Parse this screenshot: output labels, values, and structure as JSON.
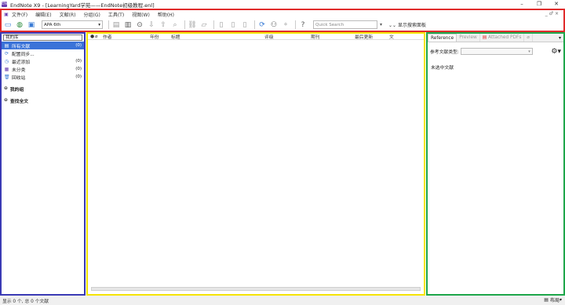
{
  "window": {
    "title": "EndNote X9 - [LearningYard学苑——EndNote初级教程.enl]",
    "controls": [
      "–",
      "❐",
      "✕"
    ]
  },
  "menu": {
    "items": [
      "文件(F)",
      "编辑(E)",
      "文献(R)",
      "分组(G)",
      "工具(T)",
      "视图(W)",
      "帮助(H)"
    ],
    "window_controls": "_ ♂ ×"
  },
  "toolbar": {
    "style_value": "APA 6th",
    "search_placeholder": "Quick Search",
    "show_search_label": "显示搜索面板"
  },
  "groups": {
    "header": "我的库",
    "items": [
      {
        "label": "所有文献",
        "count": "(0)",
        "icon": "library-icon",
        "glyph": "▤"
      },
      {
        "label": "配置同步...",
        "count": "",
        "icon": "sync-icon",
        "glyph": "⟳"
      },
      {
        "label": "最近添加",
        "count": "(0)",
        "icon": "clock-icon",
        "glyph": "◷"
      },
      {
        "label": "未分类",
        "count": "(0)",
        "icon": "unfiled-icon",
        "glyph": "▦"
      },
      {
        "label": "回收站",
        "count": "(0)",
        "icon": "trash-icon",
        "glyph": "🗑"
      }
    ],
    "sections": [
      "我的组",
      "查找全文"
    ]
  },
  "reference_list": {
    "columns": [
      "作者",
      "年份",
      "标题",
      "评级",
      "期刊",
      "最后更新",
      "文"
    ]
  },
  "right_panel": {
    "tabs": [
      "Reference",
      "Preview",
      "Attached PDFs"
    ],
    "ref_type_label": "参考文献类型:",
    "no_selection": "未选中文献"
  },
  "status": {
    "text": "显示 0 个, 总 0 个文献",
    "layout_label": "布局"
  },
  "colors": {
    "red_frame": "#e02b2b",
    "blue_frame": "#3a3ab5",
    "yellow_frame": "#f5e400",
    "green_frame": "#1ea64a",
    "selection": "#3b73d8"
  }
}
